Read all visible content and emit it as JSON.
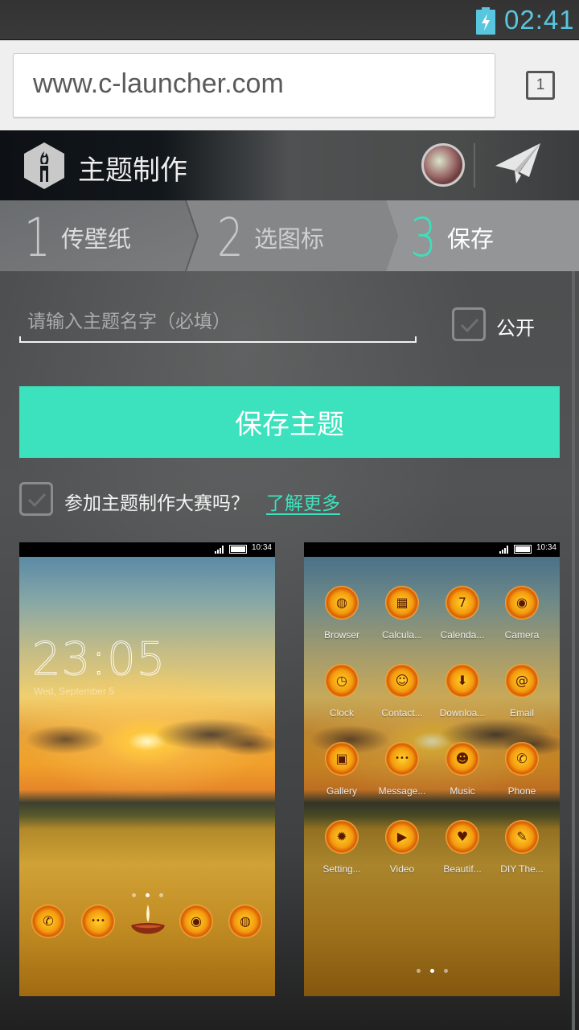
{
  "status_bar": {
    "time": "02:41",
    "battery_state": "charging",
    "accent_color": "#59c6e0"
  },
  "browser": {
    "url": "www.c-launcher.com",
    "tab_count": "1"
  },
  "app_header": {
    "title": "主题制作",
    "logo_icon": "paintbrush-hexagon-icon",
    "avatar": "user-avatar",
    "send_icon": "paper-plane-icon"
  },
  "steps": [
    {
      "number": "1",
      "label": "传壁纸",
      "active": false
    },
    {
      "number": "2",
      "label": "选图标",
      "active": false
    },
    {
      "number": "3",
      "label": "保存",
      "active": true
    }
  ],
  "form": {
    "name_input": {
      "value": "",
      "placeholder": "请输入主题名字（必填）"
    },
    "public_checkbox": {
      "label": "公开",
      "checked": false
    },
    "save_button": "保存主题",
    "contest_checkbox": {
      "label": "参加主题制作大赛吗？",
      "checked": false
    },
    "learn_more_link": "了解更多",
    "accent_color": "#3ce2bd"
  },
  "preview_lockscreen": {
    "status_time": "10:34",
    "clock": "23:05",
    "date": "Wed, September 5",
    "page_dots": 3,
    "active_page": 2,
    "dock": [
      {
        "name": "phone",
        "icon": "phone-icon",
        "glyph": "✆"
      },
      {
        "name": "messages",
        "icon": "message-icon",
        "glyph": "•••"
      },
      {
        "name": "lamp",
        "icon": "diya-lamp-icon"
      },
      {
        "name": "camera",
        "icon": "camera-icon",
        "glyph": "◉"
      },
      {
        "name": "browser",
        "icon": "globe-icon",
        "glyph": "◍"
      }
    ]
  },
  "preview_homescreen": {
    "status_time": "10:34",
    "apps": [
      {
        "name": "Browser",
        "icon": "globe-icon",
        "glyph": "◍"
      },
      {
        "name": "Calcula...",
        "icon": "calculator-icon",
        "glyph": "▦"
      },
      {
        "name": "Calenda...",
        "icon": "calendar-icon",
        "glyph": "7"
      },
      {
        "name": "Camera",
        "icon": "camera-icon",
        "glyph": "◉"
      },
      {
        "name": "Clock",
        "icon": "clock-icon",
        "glyph": "◷"
      },
      {
        "name": "Contact...",
        "icon": "contact-icon",
        "glyph": "☺"
      },
      {
        "name": "Downloa...",
        "icon": "download-icon",
        "glyph": "⬇"
      },
      {
        "name": "Email",
        "icon": "email-icon",
        "glyph": "@"
      },
      {
        "name": "Gallery",
        "icon": "gallery-icon",
        "glyph": "▣"
      },
      {
        "name": "Message...",
        "icon": "message-icon",
        "glyph": "•••"
      },
      {
        "name": "Music",
        "icon": "music-icon",
        "glyph": "☻"
      },
      {
        "name": "Phone",
        "icon": "phone-icon",
        "glyph": "✆"
      },
      {
        "name": "Setting...",
        "icon": "settings-icon",
        "glyph": "✹"
      },
      {
        "name": "Video",
        "icon": "video-icon",
        "glyph": "▶"
      },
      {
        "name": "Beautif...",
        "icon": "hearts-icon",
        "glyph": "♥"
      },
      {
        "name": "DIY The...",
        "icon": "brush-icon",
        "glyph": "✎"
      }
    ],
    "page_dots": 3,
    "active_page": 2
  }
}
